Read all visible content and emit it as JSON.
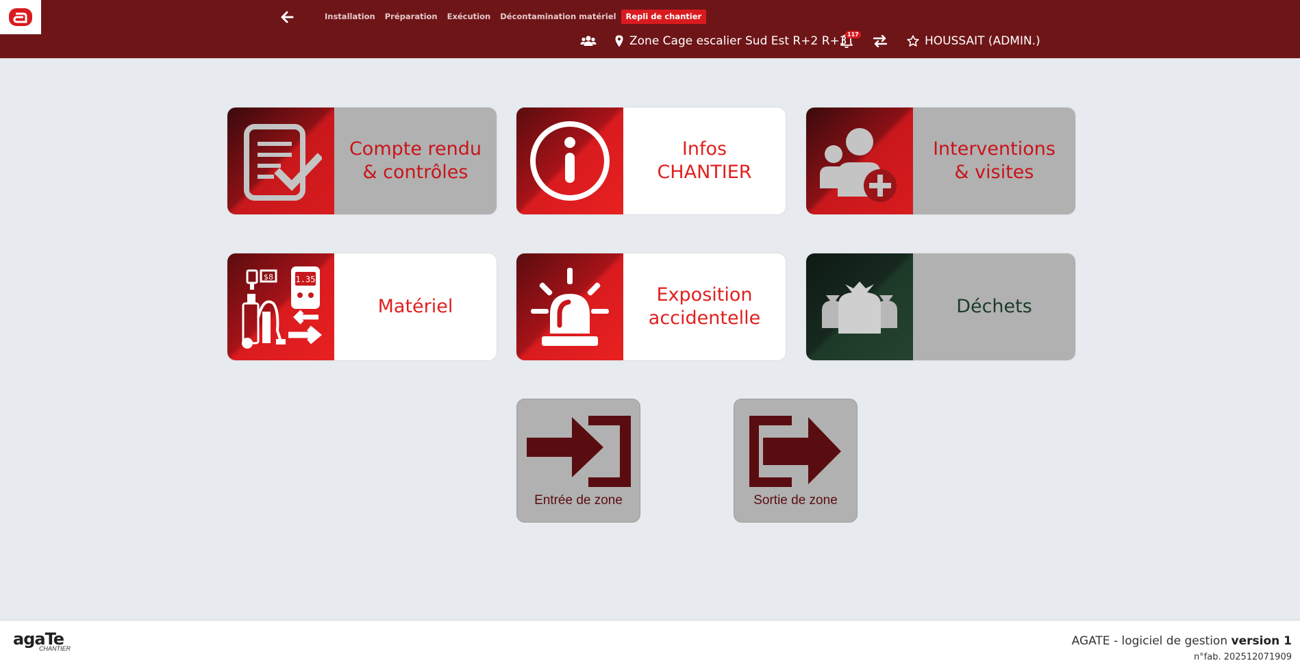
{
  "header": {
    "logo_letter": "a",
    "tabs": [
      {
        "label": "Installation",
        "active": false
      },
      {
        "label": "Préparation",
        "active": false
      },
      {
        "label": "Exécution",
        "active": false
      },
      {
        "label": "Décontamination matériel",
        "active": false
      },
      {
        "label": "Repli de chantier",
        "active": true
      }
    ],
    "zone": "Zone Cage escalier Sud Est R+2 R+3",
    "notification_count": "117",
    "user": "HOUSSAIT (ADMIN.)",
    "icons": [
      "arrow-left-icon",
      "users-icon",
      "map-marker-icon",
      "bell-icon",
      "exchange-icon",
      "star-icon"
    ]
  },
  "tiles": [
    {
      "label": "Compte rendu\n& contrôles",
      "icon": "report-check-icon",
      "style": "grey"
    },
    {
      "label": "Infos\nCHANTIER",
      "icon": "info-icon",
      "style": "white"
    },
    {
      "label": "Interventions\n& visites",
      "icon": "user-add-icon",
      "style": "grey"
    },
    {
      "label": "Matériel",
      "icon": "equipment-icon",
      "style": "white"
    },
    {
      "label": "Exposition\naccidentelle",
      "icon": "alarm-light-icon",
      "style": "white"
    },
    {
      "label": "Déchets",
      "icon": "waste-bags-icon",
      "style": "grey-green"
    }
  ],
  "zone_buttons": [
    {
      "label": "Entrée de zone",
      "icon": "enter-zone-icon"
    },
    {
      "label": "Sortie de zone",
      "icon": "exit-zone-icon"
    }
  ],
  "footer": {
    "logo_text": "agaTe",
    "logo_sub": "CHANTIER",
    "app_name": "AGATE - logiciel de gestion ",
    "version": "version 1",
    "fab": "n°fab. 202512071909"
  },
  "colors": {
    "header_bg": "#6e1518",
    "accent_red": "#d91b1f",
    "tile_grey": "#b1b1b1",
    "dechets_green": "#1c3b28",
    "page_bg": "#e7ebef"
  }
}
